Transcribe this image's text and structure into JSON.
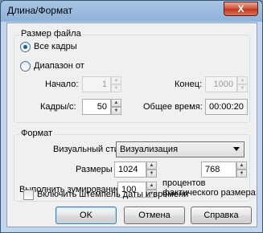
{
  "window": {
    "title": "Длина/Формат",
    "close_label": "X"
  },
  "size_group": {
    "title": "Размер файла",
    "all_frames_label": "Все кадры",
    "range_label": "Диапазон от",
    "start_label": "Начало:",
    "start_value": "1",
    "end_label": "Конец:",
    "end_value": "1000",
    "fps_label": "Кадры/с:",
    "fps_value": "50",
    "total_time_label": "Общее время:",
    "total_time_value": "00:00:20",
    "selected_option": "all_frames"
  },
  "format_group": {
    "title": "Формат",
    "visual_style_label": "Визуальный стиль",
    "visual_style_value": "Визуализация",
    "sizes_label": "Размеры",
    "width_value": "1024",
    "height_value": "768",
    "zoom_label": "Выполнить зумирование",
    "zoom_value": "100",
    "zoom_suffix_line1": "процентов",
    "zoom_suffix_line2": "фактического размера",
    "datestamp_label": "Включить штемпель даты и времени",
    "datestamp_checked": false
  },
  "buttons": {
    "ok": "OK",
    "cancel": "Отмена",
    "help": "Справка"
  }
}
